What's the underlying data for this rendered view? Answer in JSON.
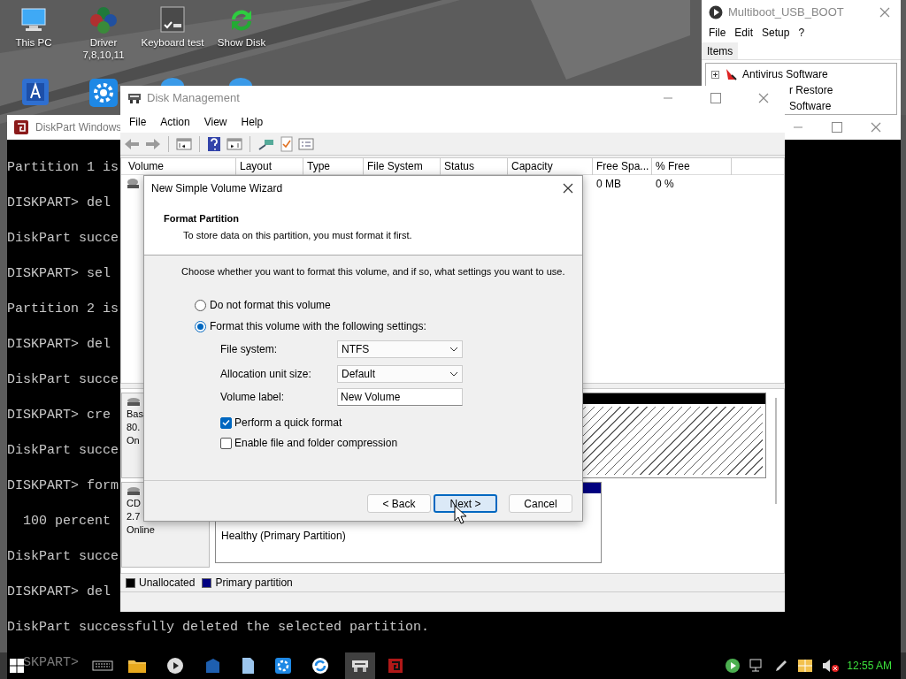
{
  "desktop_icons": [
    {
      "label": "This PC"
    },
    {
      "label": "Driver 7,8,10,11"
    },
    {
      "label": "Keyboard test"
    },
    {
      "label": "Show Disk"
    }
  ],
  "multiboot": {
    "title": "Multiboot_USB_BOOT",
    "menu": [
      "File",
      "Edit",
      "Setup",
      "?"
    ],
    "tab": "Items",
    "tree": [
      "Antivirus Software",
      "r Restore",
      "Software"
    ]
  },
  "console": {
    "title": "DiskPart Windows",
    "lines": [
      "Partition 1 is",
      "DISKPART> del",
      "DiskPart succe",
      "DISKPART> sel",
      "Partition 2 is",
      "DISKPART> del",
      "DiskPart succe",
      "DISKPART> cre",
      "DiskPart succe",
      "DISKPART> form",
      "  100 percent",
      "DiskPart succe",
      "DISKPART> del",
      "DiskPart successfully deleted the selected partition.",
      {
        "text": "SKPART>",
        "kind": "partial"
      }
    ]
  },
  "disk_management": {
    "title": "Disk Management",
    "menu": [
      "File",
      "Action",
      "View",
      "Help"
    ],
    "columns": [
      "Volume",
      "Layout",
      "Type",
      "File System",
      "Status",
      "Capacity",
      "Free Spa...",
      "% Free"
    ],
    "rows": [
      {
        "free_space": "0 MB",
        "percent_free": "0 %"
      }
    ],
    "disks": [
      {
        "lines": [
          "Bas",
          "80.",
          "On"
        ],
        "partition": {
          "kind": "unallocated"
        }
      },
      {
        "lines": [
          "CD",
          "2.7",
          "Online"
        ],
        "partition": {
          "kind": "primary",
          "status": "Healthy (Primary Partition)"
        }
      }
    ],
    "legend": [
      {
        "label": "Unallocated",
        "color": "#000000"
      },
      {
        "label": "Primary partition",
        "color": "#000080"
      }
    ]
  },
  "wizard": {
    "title": "New Simple Volume Wizard",
    "heading": "Format Partition",
    "subheading": "To store data on this partition, you must format it first.",
    "instruction": "Choose whether you want to format this volume, and if so, what settings you want to use.",
    "options": [
      {
        "label": "Do not format this volume",
        "selected": false
      },
      {
        "label": "Format this volume with the following settings:",
        "selected": true
      }
    ],
    "settings": [
      {
        "label": "File system:",
        "kind": "dropdown",
        "value": "NTFS"
      },
      {
        "label": "Allocation unit size:",
        "kind": "dropdown",
        "value": "Default"
      },
      {
        "label": "Volume label:",
        "kind": "text",
        "value": "New Volume"
      }
    ],
    "checkboxes": [
      {
        "label": "Perform a quick format",
        "checked": true
      },
      {
        "label": "Enable file and folder compression",
        "checked": false
      }
    ],
    "buttons": [
      {
        "label": "< Back",
        "focused": false
      },
      {
        "label": "Next >",
        "focused": true
      },
      {
        "label": "Cancel",
        "focused": false
      }
    ]
  },
  "taskbar": {
    "clock": "12:55 AM"
  }
}
